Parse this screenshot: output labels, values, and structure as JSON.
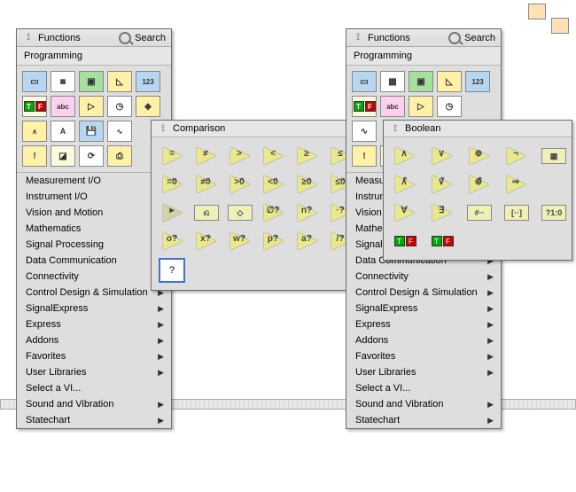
{
  "left_panel": {
    "title": "Functions",
    "search_label": "Search",
    "section_label": "Programming",
    "menu_items": [
      "Measurement I/O",
      "Instrument I/O",
      "Vision and Motion",
      "Mathematics",
      "Signal Processing",
      "Data Communication",
      "Connectivity",
      "Control Design & Simulation",
      "SignalExpress",
      "Express",
      "Addons",
      "Favorites",
      "User Libraries",
      "Select a VI...",
      "Sound and Vibration",
      "Statechart"
    ],
    "icons": [
      "struct",
      "array",
      "cluster",
      "num",
      "123",
      "TF",
      "abc",
      "cmp-tri",
      "time",
      "dlg",
      "and",
      "char",
      "file",
      "wave",
      "misc",
      "excl",
      "app",
      "sync",
      "print",
      ""
    ],
    "subpanel": {
      "title": "Comparison",
      "ops": [
        "=",
        "≠",
        ">",
        "<",
        "≥",
        "≤",
        "=0",
        "≠0",
        ">0",
        "<0",
        "≥0",
        "≤0",
        "sel",
        "max",
        "in?",
        "empty",
        "nan",
        "dec",
        "oct",
        "hex",
        "wh",
        "pr",
        "lx",
        "path",
        "?"
      ]
    }
  },
  "right_panel": {
    "title": "Functions",
    "search_label": "Search",
    "section_label": "Programming",
    "menu_items": [
      "Measur",
      "Instrum",
      "Vision a",
      "Mather",
      "Signal I",
      "Data Communication",
      "Connectivity",
      "Control Design & Simulation",
      "SignalExpress",
      "Express",
      "Addons",
      "Favorites",
      "User Libraries",
      "Select a VI...",
      "Sound and Vibration",
      "Statechart"
    ],
    "icons": [
      "struct",
      "array",
      "cluster",
      "num",
      "123",
      "TF",
      "abc",
      "cmp-tri",
      "time",
      ""
    ],
    "subpanel": {
      "title": "Boolean",
      "ops": [
        "∧",
        "∨",
        "⊕",
        "¬",
        "arr",
        "∧̄",
        "∨̄",
        "⊕̄",
        "⇒",
        "",
        "∀",
        "∃",
        "#··#",
        "[··]",
        "?1:0",
        "TF",
        "TF"
      ]
    }
  }
}
